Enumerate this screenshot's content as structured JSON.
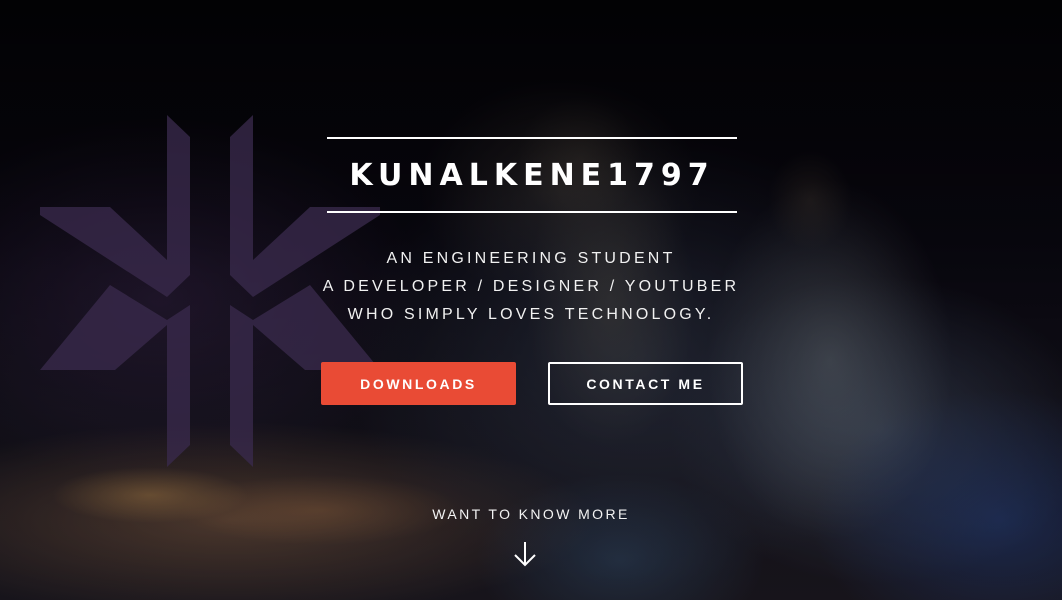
{
  "hero": {
    "title": "KUNALKENE1797",
    "tagline": [
      "AN ENGINEERING STUDENT",
      "A DEVELOPER / DESIGNER / YOUTUBER",
      "WHO SIMPLY LOVES TECHNOLOGY."
    ],
    "buttons": {
      "downloads_label": "DOWNLOADS",
      "contact_label": "CONTACT ME"
    },
    "more_label": "WANT TO KNOW MORE"
  },
  "icons": {
    "logo": "kk-monogram-logo",
    "scroll": "arrow-down-icon"
  },
  "colors": {
    "accent": "#e94b35",
    "text": "#ffffff",
    "logo": "#3a2a4c"
  }
}
